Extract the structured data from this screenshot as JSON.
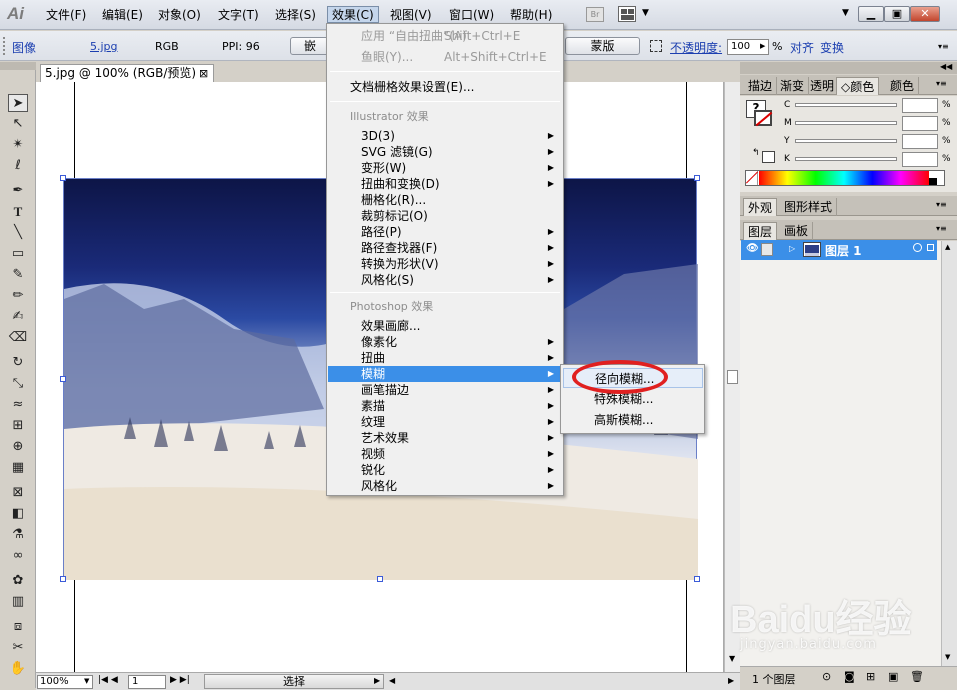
{
  "app": {
    "logo": "Ai",
    "bridge_label": "Br"
  },
  "menubar": {
    "items": [
      "文件(F)",
      "编辑(E)",
      "对象(O)",
      "文字(T)",
      "选择(S)",
      "效果(C)",
      "视图(V)",
      "窗口(W)",
      "帮助(H)"
    ],
    "active": "效果(C)"
  },
  "controlbar": {
    "type_label": "图像",
    "file_name": "5.jpg",
    "color_mode": "RGB",
    "ppi": "PPI: 96",
    "embed_label": "嵌",
    "mask_button": "蒙版",
    "opacity_label": "不透明度:",
    "opacity_value": "100",
    "percent": "%",
    "align_label": "对齐",
    "transform_label": "变换"
  },
  "document": {
    "tab_title": "5.jpg @ 100% (RGB/预览)",
    "close": "⊠"
  },
  "effect_menu": {
    "apply_last": {
      "label": "应用 “自由扭曲”(A)",
      "shortcut": "Shift+Ctrl+E"
    },
    "last_effect": {
      "label": "鱼眼(Y)...",
      "shortcut": "Alt+Shift+Ctrl+E"
    },
    "raster_settings": "文档栅格效果设置(E)...",
    "illustrator_header": "Illustrator 效果",
    "illustrator_items": [
      "3D(3)",
      "SVG 滤镜(G)",
      "变形(W)",
      "扭曲和变换(D)",
      "栅格化(R)...",
      "裁剪标记(O)",
      "路径(P)",
      "路径查找器(F)",
      "转换为形状(V)",
      "风格化(S)"
    ],
    "photoshop_header": "Photoshop 效果",
    "photoshop_items": [
      "效果画廊...",
      "像素化",
      "扭曲",
      "模糊",
      "画笔描边",
      "素描",
      "纹理",
      "艺术效果",
      "视频",
      "锐化",
      "风格化"
    ],
    "highlighted": "模糊"
  },
  "blur_submenu": {
    "items": [
      "径向模糊...",
      "特殊模糊...",
      "高斯模糊..."
    ],
    "highlighted": "径向模糊..."
  },
  "color_panel": {
    "tabs": [
      "描边",
      "渐变",
      "透明",
      "颜色",
      "颜色"
    ],
    "channels": [
      {
        "label": "C",
        "value": "",
        "unit": "%"
      },
      {
        "label": "M",
        "value": "",
        "unit": "%"
      },
      {
        "label": "Y",
        "value": "",
        "unit": "%"
      },
      {
        "label": "K",
        "value": "",
        "unit": "%"
      }
    ]
  },
  "appearance_panel": {
    "tabs": [
      "外观",
      "图形样式"
    ]
  },
  "layers_panel": {
    "tabs": [
      "图层",
      "画板"
    ],
    "layer_name": "图层 1",
    "count": "1 个图层"
  },
  "statusbar": {
    "zoom": "100%",
    "artboard": "1",
    "tool": "选择"
  },
  "watermark": {
    "brand": "Baidu经验",
    "url": "jingyan.baidu.com"
  },
  "colors": {
    "menu_highlight": "#3b8fe8",
    "annotation_circle": "#e02020",
    "layer_selected": "#3b8fe8"
  }
}
